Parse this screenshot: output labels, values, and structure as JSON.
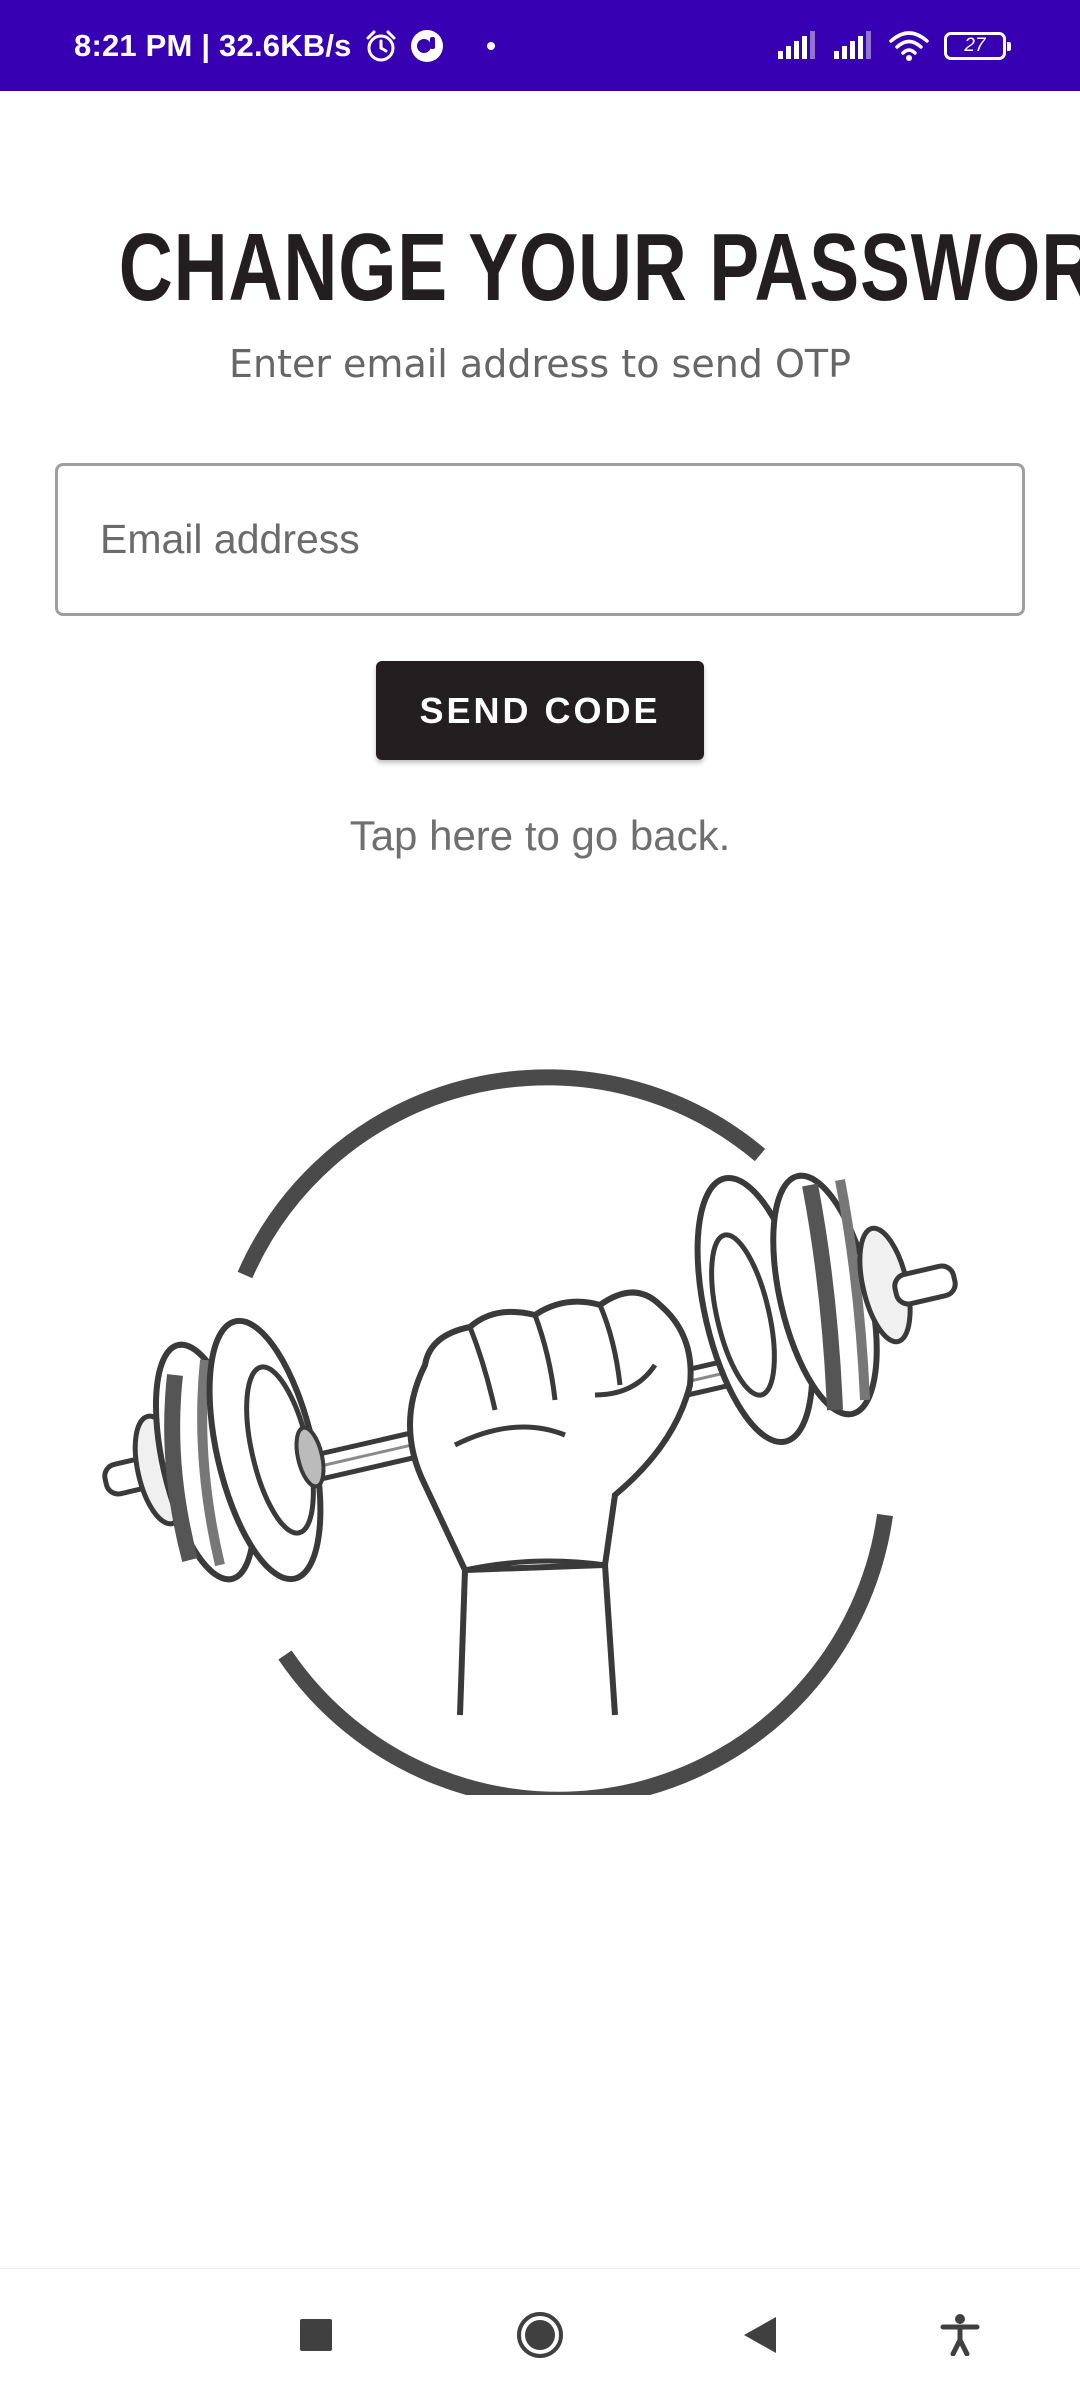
{
  "status_bar": {
    "time": "8:21 PM | 32.6KB/s",
    "battery": "27",
    "icons": [
      "alarm-icon",
      "app-notification-icon",
      "notification-dot-icon",
      "signal-icon",
      "signal-icon-2",
      "wifi-icon",
      "battery-icon"
    ],
    "background": "#3700b3"
  },
  "page": {
    "title": "CHANGE YOUR PASSWORD",
    "subtitle": "Enter email address to send OTP",
    "email_placeholder": "Email address",
    "email_value": "",
    "send_button_label": "SEND CODE",
    "back_link": "Tap here to go back.",
    "logo_icon": "dumbbell-fist-logo-icon"
  },
  "nav_bar": {
    "icons": [
      "recents-square-icon",
      "home-circle-icon",
      "back-triangle-icon",
      "accessibility-icon"
    ]
  }
}
